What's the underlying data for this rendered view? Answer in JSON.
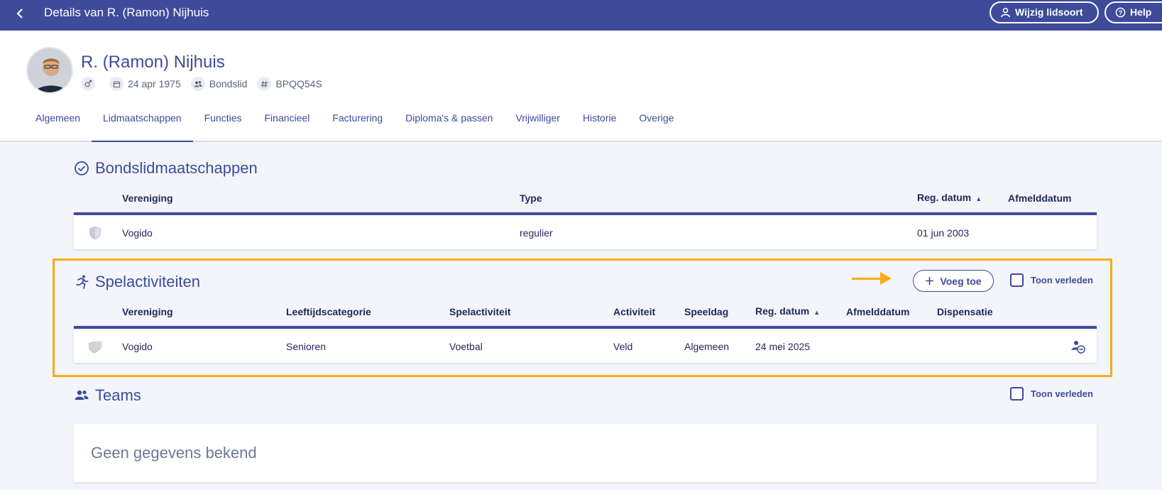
{
  "topbar": {
    "title": "Details van R. (Ramon) Nijhuis",
    "wijzig_label": "Wijzig lidsoort",
    "help_label": "Help"
  },
  "profile": {
    "name": "R. (Ramon) Nijhuis",
    "birthdate": "24 apr 1975",
    "member_type": "Bondslid",
    "code": "BPQQ54S"
  },
  "tabs": [
    "Algemeen",
    "Lidmaatschappen",
    "Functies",
    "Financieel",
    "Facturering",
    "Diploma's & passen",
    "Vrijwilliger",
    "Historie",
    "Overige"
  ],
  "active_tab": "Lidmaatschappen",
  "bond": {
    "title": "Bondslidmaatschappen",
    "headers": {
      "vereniging": "Vereniging",
      "type": "Type",
      "reg": "Reg. datum",
      "afmeld": "Afmelddatum"
    },
    "row": {
      "vereniging": "Vogido",
      "type": "regulier",
      "reg": "01 jun 2003",
      "afmeld": ""
    }
  },
  "spel": {
    "title": "Spelactiviteiten",
    "add_label": "Voeg toe",
    "toon_label": "Toon verleden",
    "headers": {
      "vereniging": "Vereniging",
      "leeftijd": "Leeftijdscategorie",
      "spel": "Spelactiviteit",
      "activiteit": "Activiteit",
      "speeldag": "Speeldag",
      "reg": "Reg. datum",
      "afmeld": "Afmelddatum",
      "dispensatie": "Dispensatie"
    },
    "row": {
      "vereniging": "Vogido",
      "leeftijd": "Senioren",
      "spel": "Voetbal",
      "activiteit": "Veld",
      "speeldag": "Algemeen",
      "reg": "24 mei 2025",
      "afmeld": "",
      "dispensatie": ""
    }
  },
  "teams": {
    "title": "Teams",
    "toon_label": "Toon verleden",
    "empty_text": "Geen gegevens bekend"
  },
  "colors": {
    "brand": "#3e4b9b",
    "highlight": "#f6ad19"
  }
}
